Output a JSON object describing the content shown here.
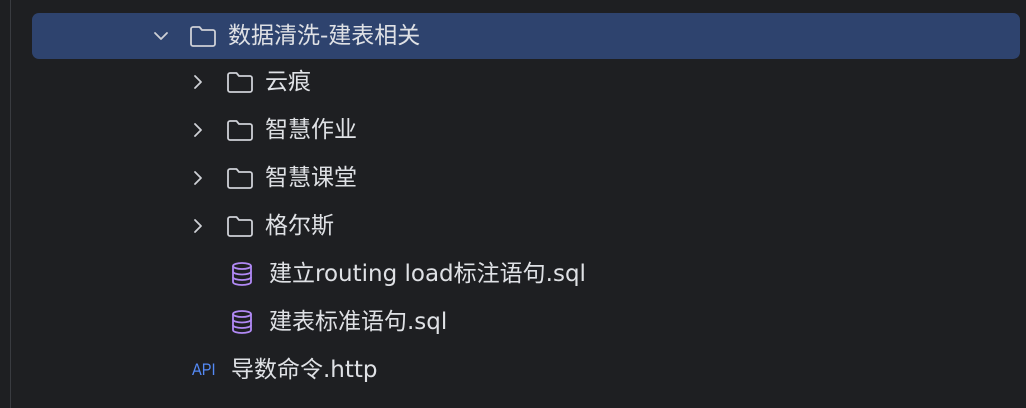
{
  "theme": {
    "background": "#1e1f22",
    "selection": "#2e436e",
    "text": "#dfe1e5",
    "icon": "#ced0d6",
    "db_icon": "#b189f5",
    "api_icon": "#548af7"
  },
  "tree": {
    "items": [
      {
        "label": "数据清洗-建表相关",
        "type": "folder",
        "icon": "folder-icon",
        "expanded": true,
        "selected": true
      },
      {
        "label": "云痕",
        "type": "folder",
        "icon": "folder-icon",
        "expanded": false
      },
      {
        "label": "智慧作业",
        "type": "folder",
        "icon": "folder-icon",
        "expanded": false
      },
      {
        "label": "智慧课堂",
        "type": "folder",
        "icon": "folder-icon",
        "expanded": false
      },
      {
        "label": "格尔斯",
        "type": "folder",
        "icon": "folder-icon",
        "expanded": false
      },
      {
        "label": "建立routing load标注语句.sql",
        "type": "file",
        "icon": "database-icon"
      },
      {
        "label": "建表标准语句.sql",
        "type": "file",
        "icon": "database-icon"
      },
      {
        "label": "导数命令.http",
        "type": "file",
        "icon": "api-icon",
        "icon_text": "API"
      }
    ]
  }
}
